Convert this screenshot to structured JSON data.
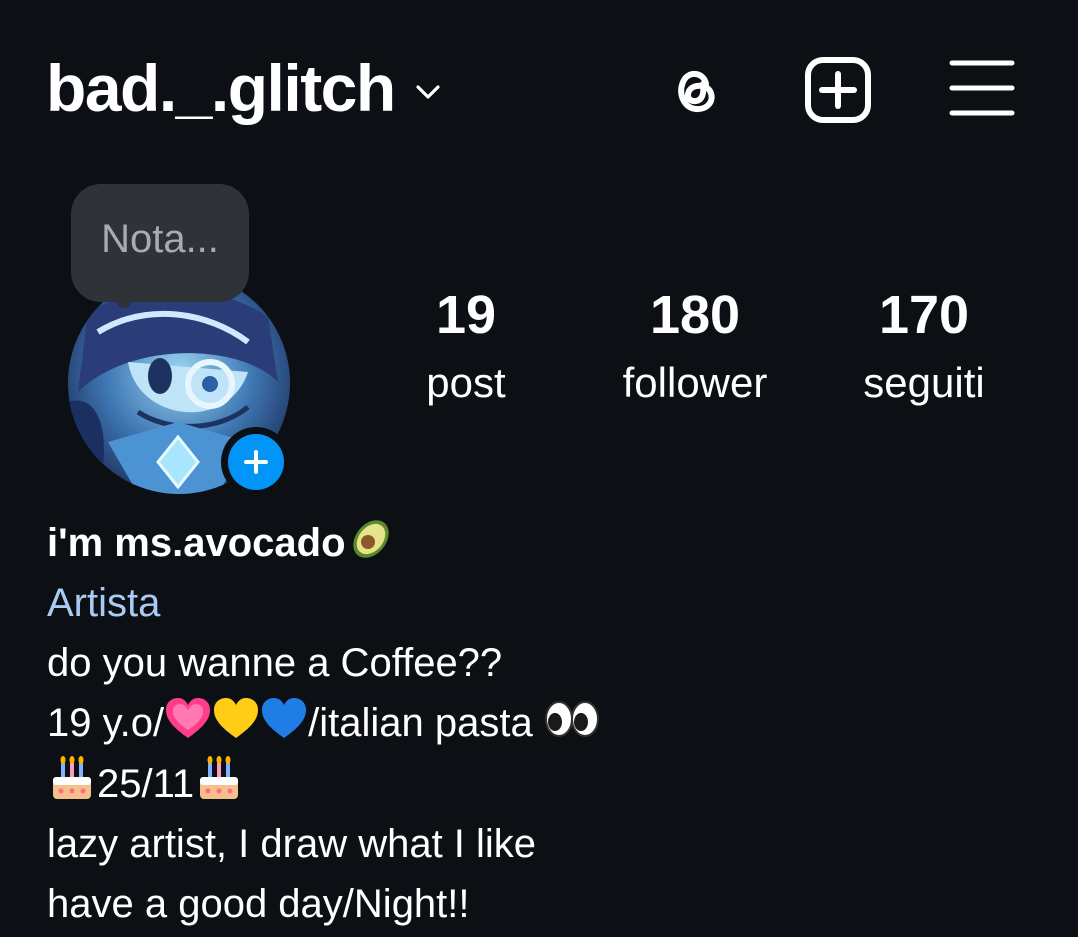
{
  "header": {
    "username": "bad._.glitch",
    "icons": [
      "chevron-down-icon",
      "threads-icon",
      "create-post-icon",
      "menu-icon"
    ]
  },
  "note": {
    "placeholder": "Nota..."
  },
  "stats": [
    {
      "value": "19",
      "label": "post"
    },
    {
      "value": "180",
      "label": "follower"
    },
    {
      "value": "170",
      "label": "seguiti"
    }
  ],
  "bio": {
    "name": "i'm ms.avocado",
    "category": "Artista",
    "line1": "do you wanne a Coffee??",
    "line2_a": "19 y.o/",
    "line2_b": "/italian pasta ",
    "line3": "25/11",
    "line4": "lazy artist, I draw what I like",
    "line5": "have a good day/Night!!"
  },
  "colors": {
    "background": "#0c1014",
    "accent_blue": "#0095f6",
    "category_text": "#a9cbf3",
    "note_bubble": "#2f3338"
  }
}
